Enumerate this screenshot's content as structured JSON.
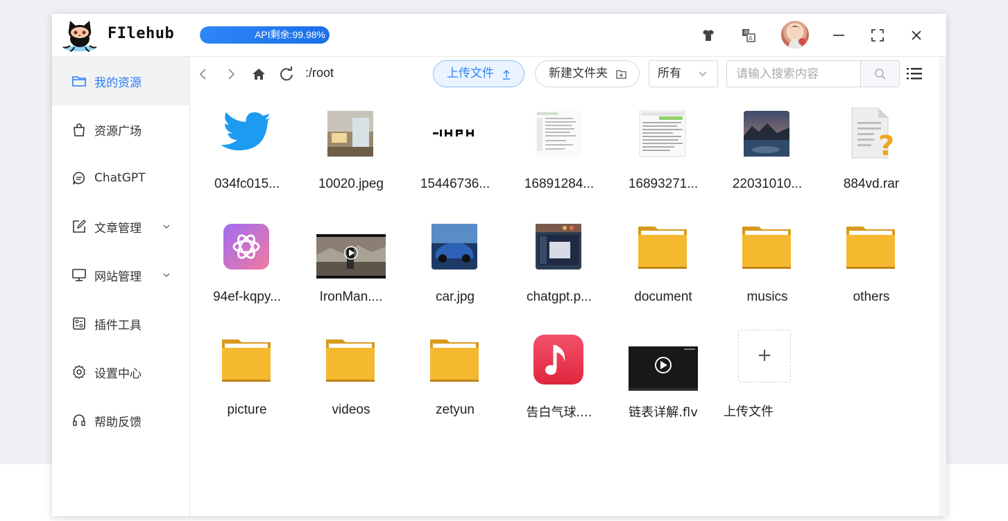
{
  "app": {
    "name": "FIlehub"
  },
  "api": {
    "label": "API剩余:99.98%",
    "remaining_percent": 99.98
  },
  "header": {
    "icons": [
      "shirt-icon",
      "translate-icon",
      "avatar",
      "minimize-icon",
      "fullscreen-icon",
      "close-icon"
    ]
  },
  "sidebar": {
    "items": [
      {
        "label": "我的资源",
        "icon": "folder-icon",
        "active": true
      },
      {
        "label": "资源广场",
        "icon": "bag-icon"
      },
      {
        "label": "ChatGPT",
        "icon": "chat-bubble-icon"
      },
      {
        "label": "文章管理",
        "icon": "edit-icon",
        "expandable": true
      },
      {
        "label": "网站管理",
        "icon": "monitor-icon",
        "expandable": true
      },
      {
        "label": "插件工具",
        "icon": "plugin-icon"
      },
      {
        "label": "设置中心",
        "icon": "gear-icon"
      },
      {
        "label": "帮助反馈",
        "icon": "headset-icon"
      }
    ]
  },
  "toolbar": {
    "path": ":/root",
    "upload_label": "上传文件",
    "new_folder_label": "新建文件夹",
    "filter_value": "所有",
    "search_placeholder": "请输入搜索内容"
  },
  "files": [
    {
      "name": "034fc015...",
      "type": "twitter-image"
    },
    {
      "name": "10020.jpeg",
      "type": "room-photo"
    },
    {
      "name": "15446736...",
      "type": "logo-text-image"
    },
    {
      "name": "16891284...",
      "type": "document-screenshot"
    },
    {
      "name": "16893271...",
      "type": "document-screenshot"
    },
    {
      "name": "22031010...",
      "type": "landscape-photo"
    },
    {
      "name": "884vd.rar",
      "type": "unknown-file"
    },
    {
      "name": "94ef-kqpy...",
      "type": "openai-logo"
    },
    {
      "name": "IronMan....",
      "type": "video"
    },
    {
      "name": "car.jpg",
      "type": "car-photo"
    },
    {
      "name": "chatgpt.p...",
      "type": "app-screenshot"
    },
    {
      "name": "document",
      "type": "folder"
    },
    {
      "name": "musics",
      "type": "folder"
    },
    {
      "name": "others",
      "type": "folder"
    },
    {
      "name": "picture",
      "type": "folder"
    },
    {
      "name": "videos",
      "type": "folder"
    },
    {
      "name": "zetyun",
      "type": "folder"
    },
    {
      "name": "告白气球....",
      "type": "music"
    },
    {
      "name": "链表详解.flv",
      "type": "video"
    }
  ],
  "upload_tile": {
    "plus": "+",
    "label": "上传文件"
  },
  "colors": {
    "accent": "#2f86f6",
    "folder": "#f2b632",
    "active_bg": "#f1f2f4"
  }
}
